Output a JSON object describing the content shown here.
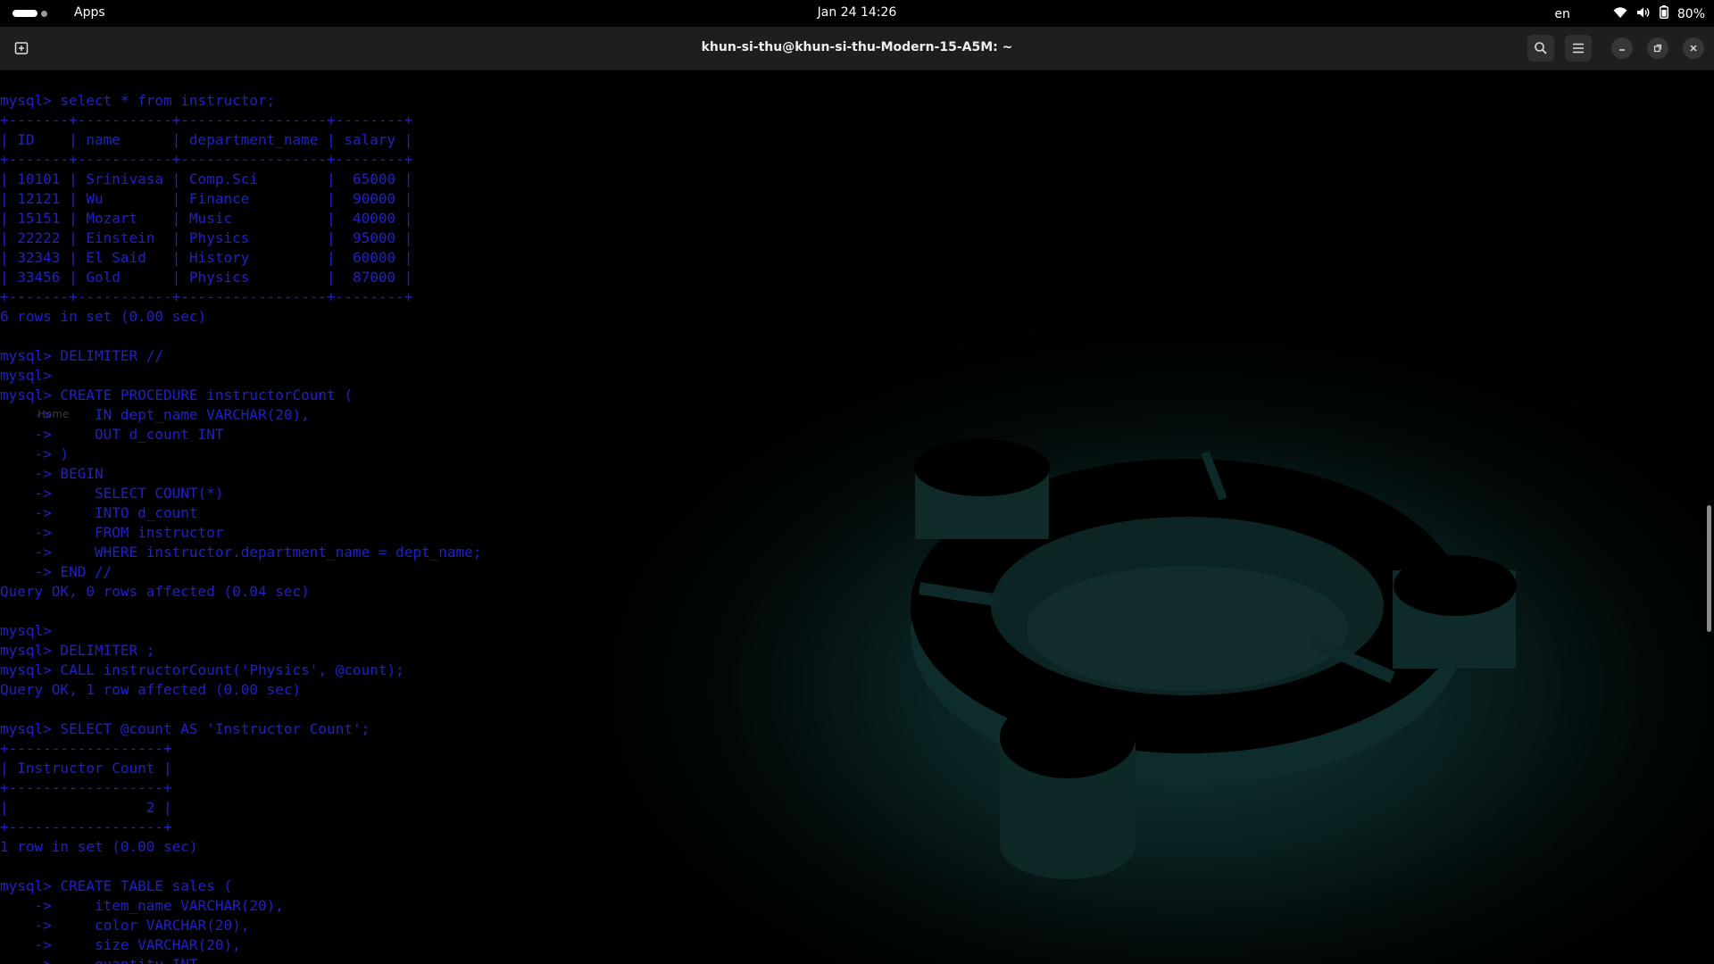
{
  "topbar": {
    "apps_label": "Apps",
    "clock": "Jan 24  14:26",
    "language": "en",
    "battery": "80%",
    "icons": [
      "activities-indicator-icon",
      "wifi-icon",
      "volume-icon",
      "battery-icon"
    ]
  },
  "window": {
    "title": "khun-si-thu@khun-si-thu-Modern-15-A5M: ~",
    "icons": [
      "new-tab-icon",
      "search-icon",
      "menu-icon",
      "minimize-icon",
      "restore-icon",
      "close-icon"
    ]
  },
  "desktop_ghost": {
    "home_label": "Home"
  },
  "terminal": {
    "text_color": "#2020c8",
    "lines": [
      "mysql> select * from instructor;",
      "+-------+-----------+-----------------+--------+",
      "| ID    | name      | department_name | salary |",
      "+-------+-----------+-----------------+--------+",
      "| 10101 | Srinivasa | Comp.Sci        |  65000 |",
      "| 12121 | Wu        | Finance         |  90000 |",
      "| 15151 | Mozart    | Music           |  40000 |",
      "| 22222 | Einstein  | Physics         |  95000 |",
      "| 32343 | El Said   | History         |  60000 |",
      "| 33456 | Gold      | Physics         |  87000 |",
      "+-------+-----------+-----------------+--------+",
      "6 rows in set (0.00 sec)",
      "",
      "mysql> DELIMITER //",
      "mysql>",
      "mysql> CREATE PROCEDURE instructorCount (",
      "    ->     IN dept_name VARCHAR(20),",
      "    ->     OUT d_count INT",
      "    -> )",
      "    -> BEGIN",
      "    ->     SELECT COUNT(*)",
      "    ->     INTO d_count",
      "    ->     FROM instructor",
      "    ->     WHERE instructor.department_name = dept_name;",
      "    -> END //",
      "Query OK, 0 rows affected (0.04 sec)",
      "",
      "mysql>",
      "mysql> DELIMITER ;",
      "mysql> CALL instructorCount('Physics', @count);",
      "Query OK, 1 row affected (0.00 sec)",
      "",
      "mysql> SELECT @count AS 'Instructor Count';",
      "+------------------+",
      "| Instructor Count |",
      "+------------------+",
      "|                2 |",
      "+------------------+",
      "1 row in set (0.00 sec)",
      "",
      "mysql> CREATE TABLE sales (",
      "    ->     item_name VARCHAR(20),",
      "    ->     color VARCHAR(20),",
      "    ->     size VARCHAR(20),",
      "    ->     quantity INT"
    ]
  }
}
